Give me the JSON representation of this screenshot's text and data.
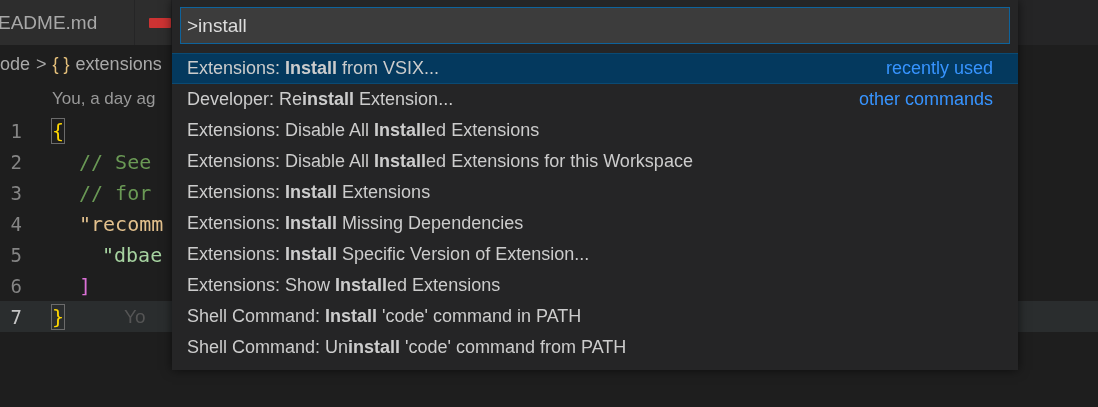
{
  "editor": {
    "tabs": [
      {
        "label": "EADME.md",
        "selected": false
      },
      {
        "selected": false
      }
    ],
    "breadcrumb": [
      "ode",
      ">",
      "{ }",
      "extensions"
    ],
    "codelens": "You, a day ag",
    "lines": [
      {
        "number": "1",
        "kind": "brace",
        "text": "{",
        "current": false
      },
      {
        "number": "2",
        "kind": "comment",
        "text": "// See",
        "current": false
      },
      {
        "number": "3",
        "kind": "comment",
        "text": "// for",
        "current": false
      },
      {
        "number": "4",
        "kind": "key",
        "text": "\"recomm",
        "current": false
      },
      {
        "number": "5",
        "kind": "string",
        "text": "\"dbae",
        "current": false
      },
      {
        "number": "6",
        "kind": "bracket",
        "text": "]",
        "current": false
      },
      {
        "number": "7",
        "kind": "brace",
        "text": "}",
        "current": true,
        "blame": "Yo"
      }
    ]
  },
  "palette": {
    "input": {
      "value": ">install"
    },
    "items": [
      {
        "label": "Extensions: **Install** from VSIX...",
        "detail": "recently used",
        "selected": true
      },
      {
        "label": "Developer: Re**install** Extension...",
        "detail": "other commands",
        "selected": false
      },
      {
        "label": "Extensions: Disable All **Install**ed Extensions",
        "selected": false
      },
      {
        "label": "Extensions: Disable All **Install**ed Extensions for this Workspace",
        "selected": false
      },
      {
        "label": "Extensions: **Install** Extensions",
        "selected": false
      },
      {
        "label": "Extensions: **Install** Missing Dependencies",
        "selected": false
      },
      {
        "label": "Extensions: **Install** Specific Version of Extension...",
        "selected": false
      },
      {
        "label": "Extensions: Show **Install**ed Extensions",
        "selected": false
      },
      {
        "label": "Shell Command: **Install** 'code' command in PATH",
        "selected": false
      },
      {
        "label": "Shell Command: Un**install** 'code' command from PATH",
        "selected": false
      }
    ]
  }
}
